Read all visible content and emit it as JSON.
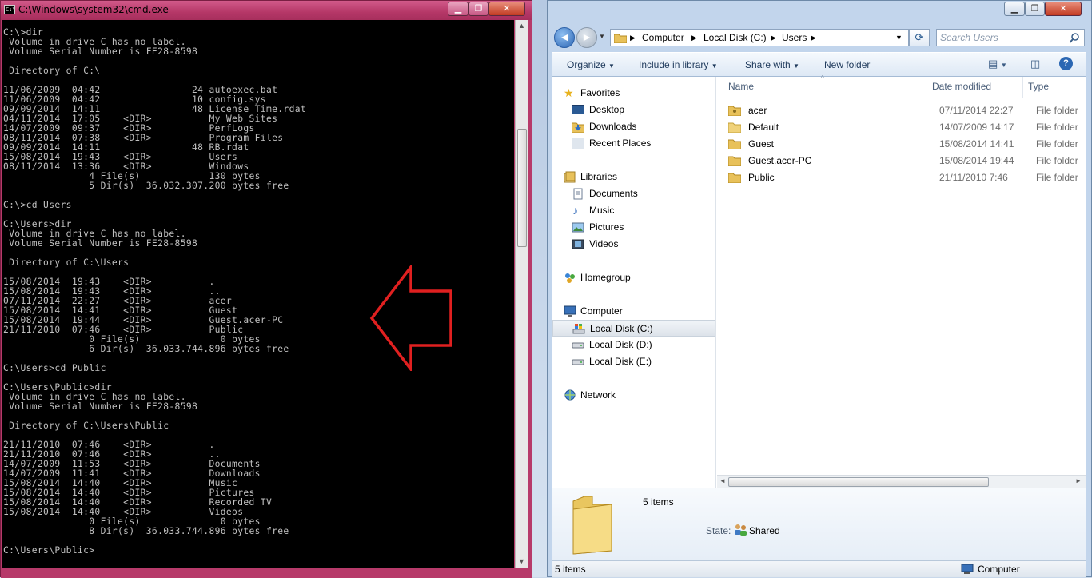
{
  "cmd": {
    "title": "C:\\Windows\\system32\\cmd.exe",
    "output": "C:\\>dir\n Volume in drive C has no label.\n Volume Serial Number is FE28-8598\n\n Directory of C:\\\n\n11/06/2009  04:42                24 autoexec.bat\n11/06/2009  04:42                10 config.sys\n09/09/2014  14:11                48 License_Time.rdat\n04/11/2014  17:05    <DIR>          My Web Sites\n14/07/2009  09:37    <DIR>          PerfLogs\n08/11/2014  07:38    <DIR>          Program Files\n09/09/2014  14:11                48 RB.rdat\n15/08/2014  19:43    <DIR>          Users\n08/11/2014  13:36    <DIR>          Windows\n               4 File(s)            130 bytes\n               5 Dir(s)  36.032.307.200 bytes free\n\nC:\\>cd Users\n\nC:\\Users>dir\n Volume in drive C has no label.\n Volume Serial Number is FE28-8598\n\n Directory of C:\\Users\n\n15/08/2014  19:43    <DIR>          .\n15/08/2014  19:43    <DIR>          ..\n07/11/2014  22:27    <DIR>          acer\n15/08/2014  14:41    <DIR>          Guest\n15/08/2014  19:44    <DIR>          Guest.acer-PC\n21/11/2010  07:46    <DIR>          Public\n               0 File(s)              0 bytes\n               6 Dir(s)  36.033.744.896 bytes free\n\nC:\\Users>cd Public\n\nC:\\Users\\Public>dir\n Volume in drive C has no label.\n Volume Serial Number is FE28-8598\n\n Directory of C:\\Users\\Public\n\n21/11/2010  07:46    <DIR>          .\n21/11/2010  07:46    <DIR>          ..\n14/07/2009  11:53    <DIR>          Documents\n14/07/2009  11:41    <DIR>          Downloads\n15/08/2014  14:40    <DIR>          Music\n15/08/2014  14:40    <DIR>          Pictures\n15/08/2014  14:40    <DIR>          Recorded TV\n15/08/2014  14:40    <DIR>          Videos\n               0 File(s)              0 bytes\n               8 Dir(s)  36.033.744.896 bytes free\n\nC:\\Users\\Public>"
  },
  "explorer": {
    "breadcrumb": [
      "Computer",
      "Local Disk (C:)",
      "Users"
    ],
    "search_placeholder": "Search Users",
    "toolbar": {
      "organize": "Organize",
      "include": "Include in library",
      "share": "Share with",
      "new_folder": "New folder"
    },
    "nav": {
      "favorites": "Favorites",
      "desktop": "Desktop",
      "downloads": "Downloads",
      "recent": "Recent Places",
      "libraries": "Libraries",
      "documents": "Documents",
      "music": "Music",
      "pictures": "Pictures",
      "videos": "Videos",
      "homegroup": "Homegroup",
      "computer": "Computer",
      "disk_c": "Local Disk (C:)",
      "disk_d": "Local Disk (D:)",
      "disk_e": "Local Disk (E:)",
      "network": "Network"
    },
    "columns": {
      "name": "Name",
      "date": "Date modified",
      "type": "Type"
    },
    "files": [
      {
        "name": "acer",
        "date": "07/11/2014 22:27",
        "type": "File folder"
      },
      {
        "name": "Default",
        "date": "14/07/2009 14:17",
        "type": "File folder"
      },
      {
        "name": "Guest",
        "date": "15/08/2014 14:41",
        "type": "File folder"
      },
      {
        "name": "Guest.acer-PC",
        "date": "15/08/2014 19:44",
        "type": "File folder"
      },
      {
        "name": "Public",
        "date": "21/11/2010 7:46",
        "type": "File folder"
      }
    ],
    "details": {
      "count": "5 items",
      "state_label": "State:",
      "state_value": "Shared"
    },
    "status": {
      "items": "5 items",
      "location": "Computer"
    }
  },
  "colors": {
    "cmd_frame": "#b73a6a",
    "arrow": "#e02020",
    "explorer_frame": "#c2d5ec"
  }
}
